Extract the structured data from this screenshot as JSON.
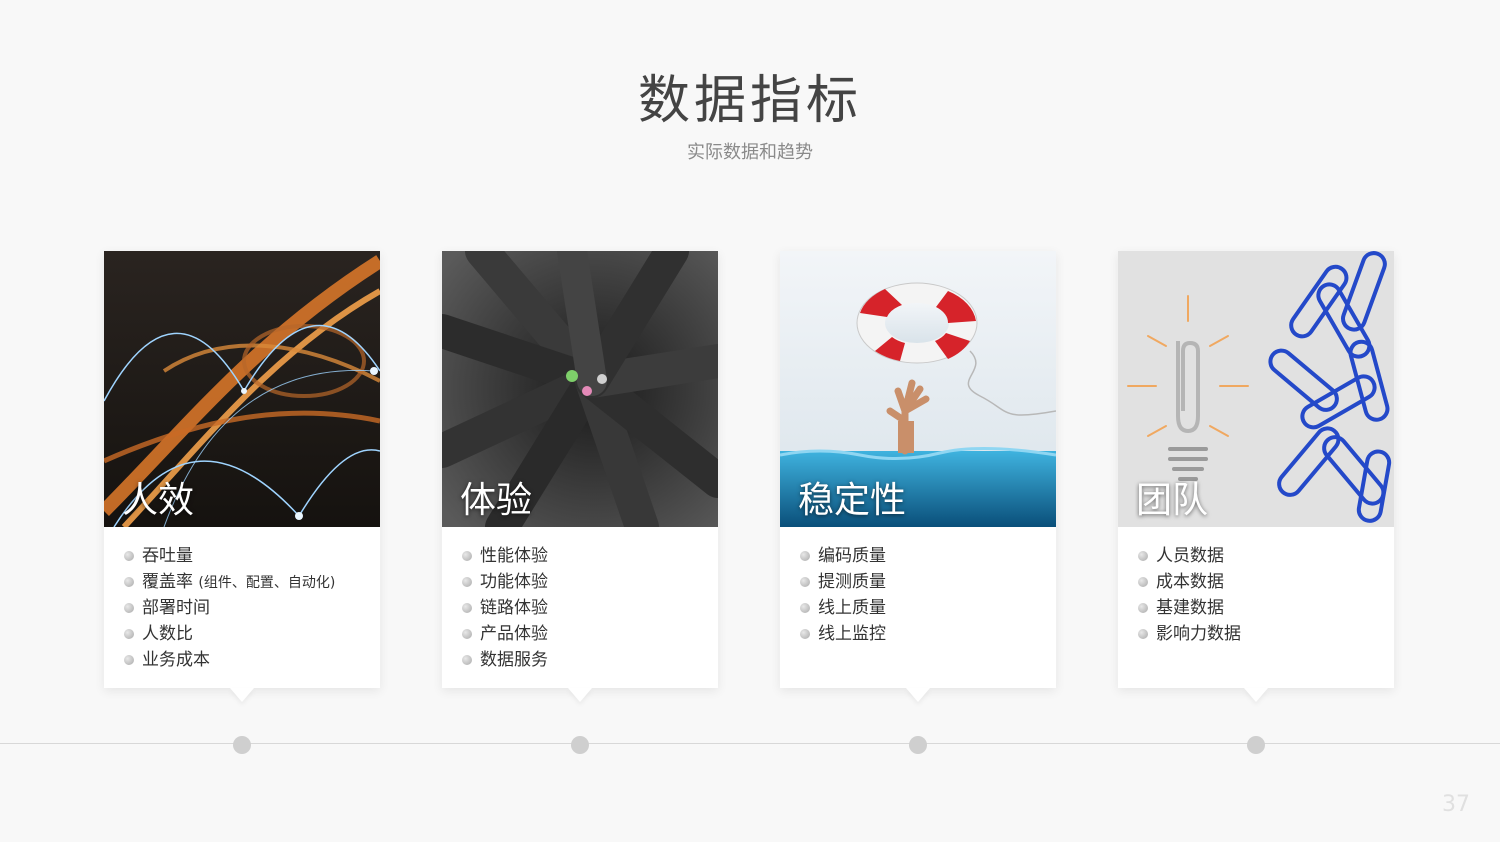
{
  "slide": {
    "title": "数据指标",
    "subtitle": "实际数据和趋势",
    "page_number": "37"
  },
  "cards": [
    {
      "title": "人效",
      "image": "highway-network-photo",
      "items": [
        {
          "text": "吞吐量"
        },
        {
          "text": "覆盖率",
          "note": "(组件、配置、自动化)"
        },
        {
          "text": "部署时间"
        },
        {
          "text": "人数比"
        },
        {
          "text": "业务成本"
        }
      ]
    },
    {
      "title": "体验",
      "image": "colored-pencils-photo",
      "items": [
        {
          "text": "性能体验"
        },
        {
          "text": "功能体验"
        },
        {
          "text": "链路体验"
        },
        {
          "text": "产品体验"
        },
        {
          "text": "数据服务"
        }
      ]
    },
    {
      "title": "稳定性",
      "image": "lifebuoy-rescue-photo",
      "items": [
        {
          "text": "编码质量"
        },
        {
          "text": "提测质量"
        },
        {
          "text": "线上质量"
        },
        {
          "text": "线上监控"
        }
      ]
    },
    {
      "title": "团队",
      "image": "paperclip-bulb-photo",
      "items": [
        {
          "text": "人员数据"
        },
        {
          "text": "成本数据"
        },
        {
          "text": "基建数据"
        },
        {
          "text": "影响力数据"
        }
      ]
    }
  ],
  "colors": {
    "background": "#f8f8f8",
    "card": "#ffffff",
    "timeline_dot": "#cfcfcf"
  }
}
